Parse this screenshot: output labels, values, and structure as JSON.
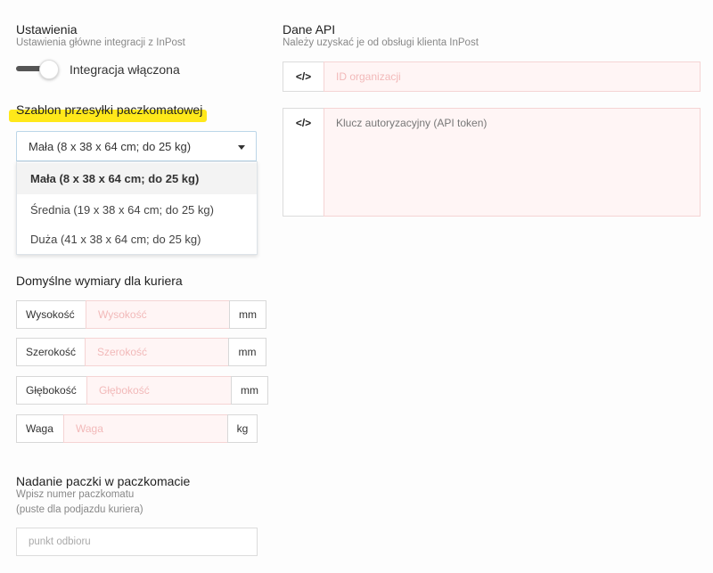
{
  "settings": {
    "title": "Ustawienia",
    "subtitle": "Ustawienia główne integracji z InPost",
    "toggle_label": "Integracja włączona"
  },
  "template": {
    "title": "Szablon przesyłki paczkomatowej",
    "selected": "Mała (8 x 38 x 64 cm; do 25 kg)",
    "options": [
      "Mała (8 x 38 x 64 cm; do 25 kg)",
      "Średnia (19 x 38 x 64 cm; do 25 kg)",
      "Duża (41 x 38 x 64 cm; do 25 kg)"
    ]
  },
  "dimensions": {
    "title": "Domyślne wymiary dla kuriera",
    "fields": [
      {
        "label": "Wysokość",
        "placeholder": "Wysokość",
        "unit": "mm"
      },
      {
        "label": "Szerokość",
        "placeholder": "Szerokość",
        "unit": "mm"
      },
      {
        "label": "Głębokość",
        "placeholder": "Głębokość",
        "unit": "mm"
      },
      {
        "label": "Waga",
        "placeholder": "Waga",
        "unit": "kg"
      }
    ]
  },
  "pickup": {
    "title": "Nadanie paczki w paczkomacie",
    "subtitle_line1": "Wpisz numer paczkomatu",
    "subtitle_line2": "(puste dla podjazdu kuriera)",
    "placeholder": "punkt odbioru"
  },
  "api": {
    "title": "Dane API",
    "subtitle": "Należy uzyskać je od obsługi klienta InPost",
    "icon_glyph": "</>",
    "org_placeholder": "ID organizacji",
    "token_placeholder": "Klucz autoryzacyjny (API token)"
  },
  "colors": {
    "highlight": "#ffe81a",
    "invalid_bg": "#fff5f5",
    "invalid_border": "#f5d4d4"
  }
}
